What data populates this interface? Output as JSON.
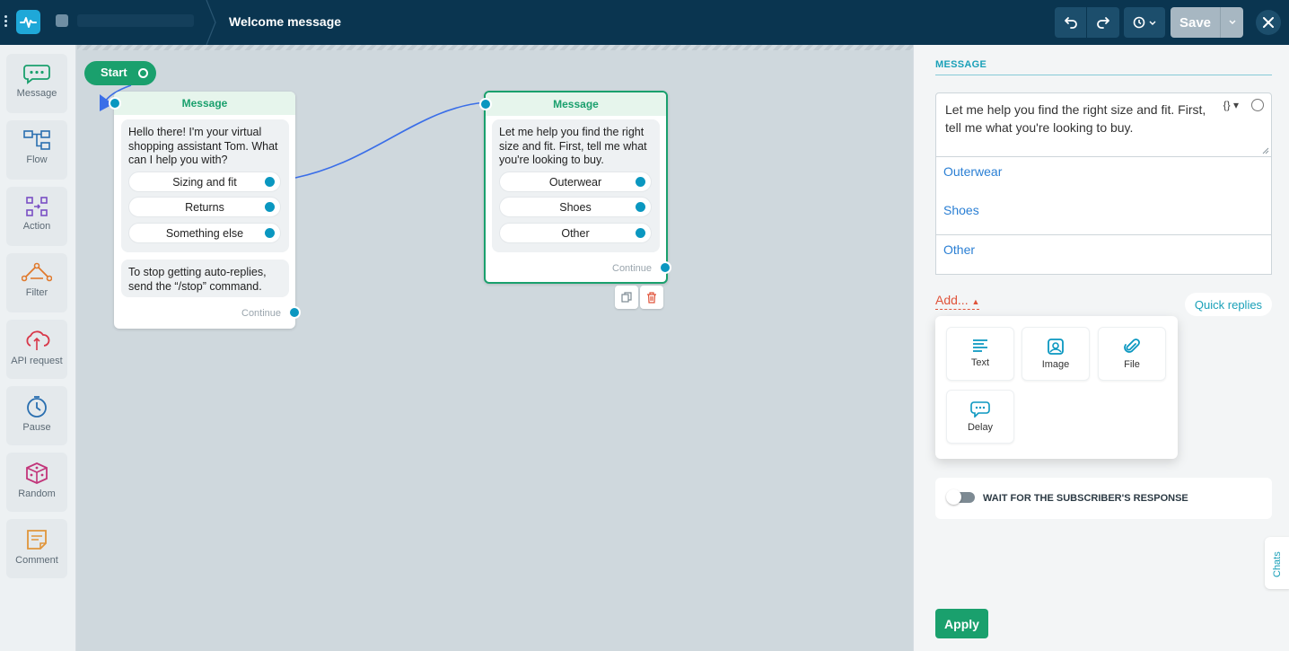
{
  "topbar": {
    "title": "Welcome message",
    "save_label": "Save"
  },
  "sidebar": {
    "items": [
      {
        "label": "Message",
        "icon": "message-icon"
      },
      {
        "label": "Flow",
        "icon": "flow-icon"
      },
      {
        "label": "Action",
        "icon": "action-icon"
      },
      {
        "label": "Filter",
        "icon": "filter-icon"
      },
      {
        "label": "API request",
        "icon": "api-request-icon"
      },
      {
        "label": "Pause",
        "icon": "pause-icon"
      },
      {
        "label": "Random",
        "icon": "random-icon"
      },
      {
        "label": "Comment",
        "icon": "comment-icon"
      }
    ]
  },
  "canvas": {
    "start_label": "Start",
    "node1": {
      "header": "Message",
      "text": "Hello there! I'm your virtual shopping assistant Tom. What can I help you with?",
      "buttons": [
        "Sizing and fit",
        "Returns",
        "Something else"
      ],
      "footer_text": "To stop getting auto-replies, send the “/stop” command.",
      "continue": "Continue"
    },
    "node2": {
      "header": "Message",
      "text": "Let me help you find the right size and fit. First, tell me what you're looking to buy.",
      "buttons": [
        "Outerwear",
        "Shoes",
        "Other"
      ],
      "continue": "Continue"
    }
  },
  "panel": {
    "section_title": "MESSAGE",
    "message_text": "Let me help you find the right size and fit. First, tell me what you're looking to buy.",
    "variable_glyph": "{} ▾",
    "replies": [
      "Outerwear",
      "Shoes",
      "Other"
    ],
    "add_label": "Add...",
    "quick_replies_label": "Quick replies",
    "add_options": [
      {
        "label": "Text",
        "icon": "text-icon"
      },
      {
        "label": "Image",
        "icon": "image-icon"
      },
      {
        "label": "File",
        "icon": "file-icon"
      },
      {
        "label": "Delay",
        "icon": "delay-icon"
      }
    ],
    "wait_label": "WAIT FOR THE SUBSCRIBER'S RESPONSE",
    "wait_enabled": false,
    "chats_tab": "Chats",
    "apply_label": "Apply"
  },
  "colors": {
    "topbar": "#0a3550",
    "accent_green": "#1aa06d",
    "accent_teal": "#1aa0b8",
    "port_blue": "#0a97c0",
    "link_blue": "#2a7fd4",
    "add_red": "#e0533a"
  }
}
